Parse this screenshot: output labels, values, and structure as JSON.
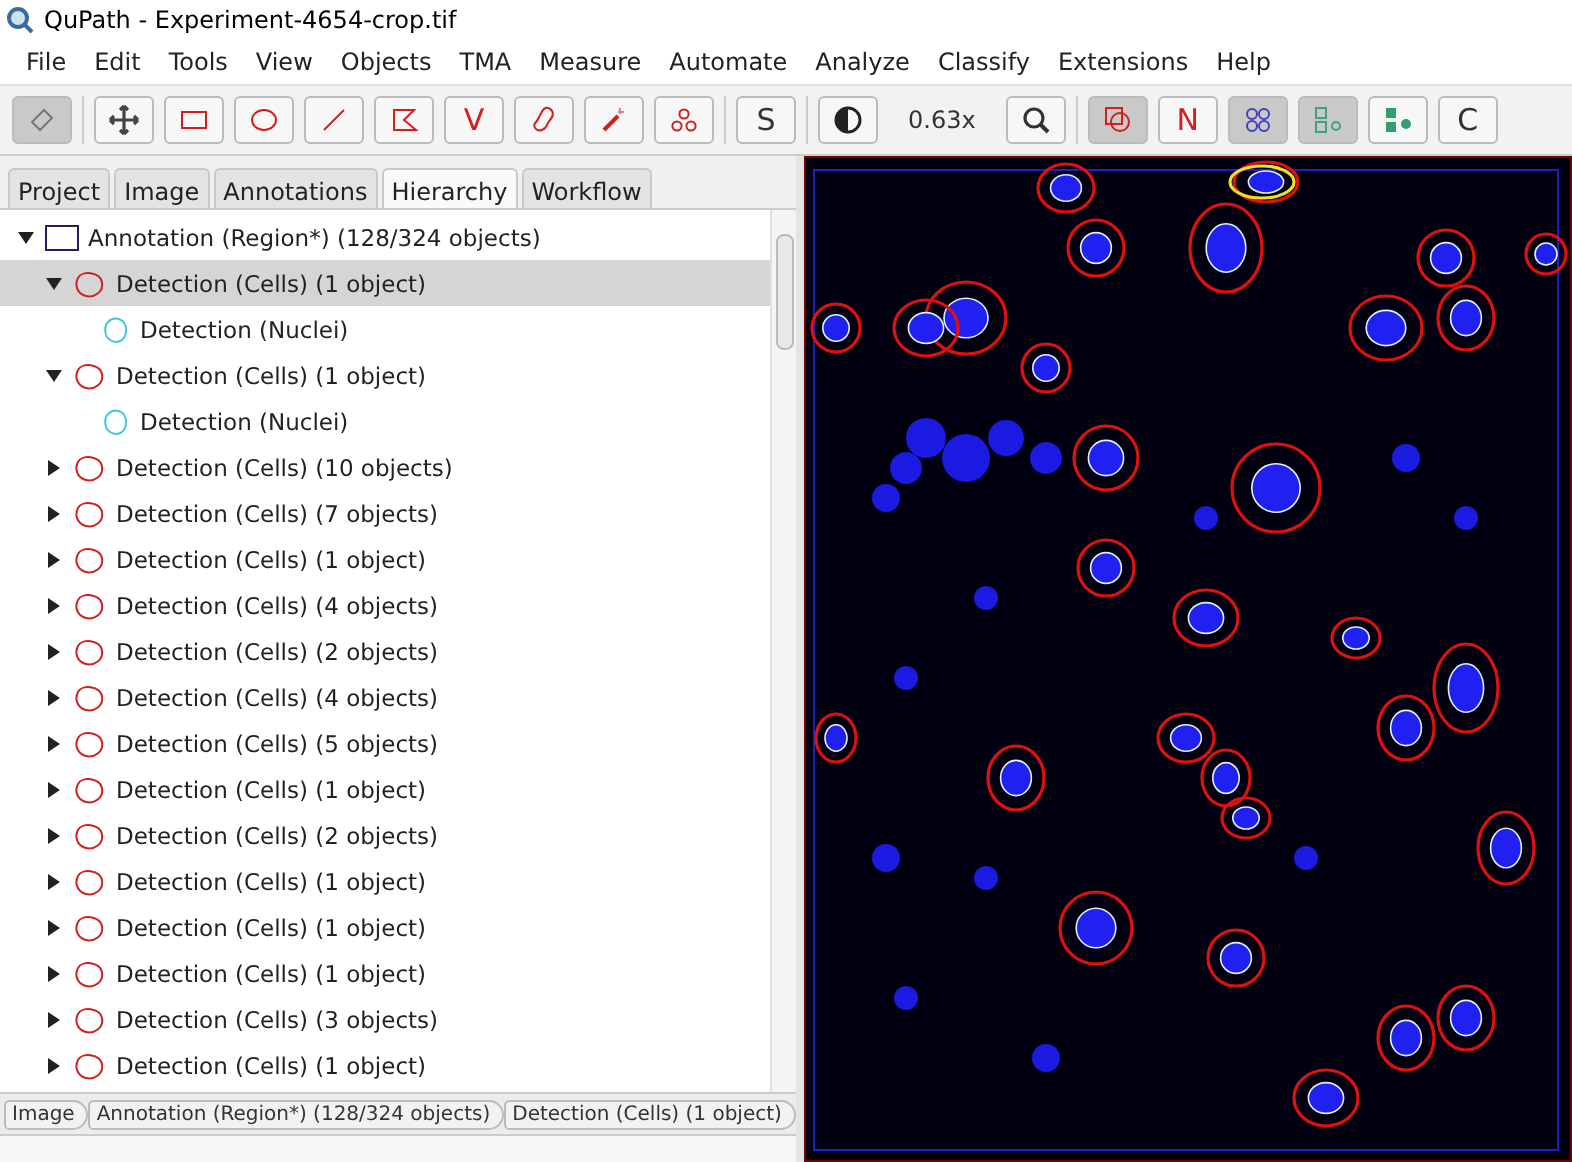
{
  "window": {
    "title": "QuPath - Experiment-4654-crop.tif"
  },
  "menu": [
    "File",
    "Edit",
    "Tools",
    "View",
    "Objects",
    "TMA",
    "Measure",
    "Automate",
    "Analyze",
    "Classify",
    "Extensions",
    "Help"
  ],
  "toolbar": [
    {
      "kind": "icon",
      "selected": true
    },
    {
      "kind": "sep"
    },
    {
      "kind": "icon",
      "selected": false
    },
    {
      "kind": "icon",
      "selected": false
    },
    {
      "kind": "icon",
      "selected": false
    },
    {
      "kind": "icon",
      "selected": false
    },
    {
      "kind": "icon",
      "selected": false
    },
    {
      "kind": "text",
      "label": "V",
      "selected": false,
      "color": "#d02020"
    },
    {
      "kind": "icon",
      "selected": false
    },
    {
      "kind": "icon",
      "selected": false
    },
    {
      "kind": "icon",
      "selected": false
    },
    {
      "kind": "sep"
    },
    {
      "kind": "text",
      "label": "S",
      "selected": false,
      "color": "#333333"
    },
    {
      "kind": "sep"
    },
    {
      "kind": "icon",
      "selected": false
    },
    {
      "kind": "label",
      "label": "0.63x"
    },
    {
      "kind": "icon",
      "selected": false
    },
    {
      "kind": "sep"
    },
    {
      "kind": "icon",
      "selected": true
    },
    {
      "kind": "text",
      "label": "N",
      "selected": false,
      "color": "#d02020"
    },
    {
      "kind": "icon",
      "selected": true
    },
    {
      "kind": "icon",
      "selected": true
    },
    {
      "kind": "icon",
      "selected": false
    },
    {
      "kind": "text",
      "label": "C",
      "selected": false,
      "color": "#333333"
    }
  ],
  "tabs": [
    {
      "label": "Project",
      "selected": false
    },
    {
      "label": "Image",
      "selected": false
    },
    {
      "label": "Annotations",
      "selected": false
    },
    {
      "label": "Hierarchy",
      "selected": true
    },
    {
      "label": "Workflow",
      "selected": false
    }
  ],
  "tree": [
    {
      "kind": "annotation",
      "label": "Annotation (Region*) (128/324 objects)",
      "expanded": true,
      "selected": false,
      "children": [
        {
          "kind": "cells",
          "label": "Detection (Cells) (1 object)",
          "expanded": true,
          "selected": true,
          "children": [
            {
              "kind": "nuclei",
              "label": "Detection (Nuclei)",
              "selected": false
            }
          ]
        },
        {
          "kind": "cells",
          "label": "Detection (Cells) (1 object)",
          "expanded": true,
          "selected": false,
          "children": [
            {
              "kind": "nuclei",
              "label": "Detection (Nuclei)",
              "selected": false
            }
          ]
        },
        {
          "kind": "cells",
          "label": "Detection (Cells) (10 objects)",
          "expanded": false,
          "selected": false
        },
        {
          "kind": "cells",
          "label": "Detection (Cells) (7 objects)",
          "expanded": false,
          "selected": false
        },
        {
          "kind": "cells",
          "label": "Detection (Cells) (1 object)",
          "expanded": false,
          "selected": false
        },
        {
          "kind": "cells",
          "label": "Detection (Cells) (4 objects)",
          "expanded": false,
          "selected": false
        },
        {
          "kind": "cells",
          "label": "Detection (Cells) (2 objects)",
          "expanded": false,
          "selected": false
        },
        {
          "kind": "cells",
          "label": "Detection (Cells) (4 objects)",
          "expanded": false,
          "selected": false
        },
        {
          "kind": "cells",
          "label": "Detection (Cells) (5 objects)",
          "expanded": false,
          "selected": false
        },
        {
          "kind": "cells",
          "label": "Detection (Cells) (1 object)",
          "expanded": false,
          "selected": false
        },
        {
          "kind": "cells",
          "label": "Detection (Cells) (2 objects)",
          "expanded": false,
          "selected": false
        },
        {
          "kind": "cells",
          "label": "Detection (Cells) (1 object)",
          "expanded": false,
          "selected": false
        },
        {
          "kind": "cells",
          "label": "Detection (Cells) (1 object)",
          "expanded": false,
          "selected": false
        },
        {
          "kind": "cells",
          "label": "Detection (Cells) (1 object)",
          "expanded": false,
          "selected": false
        },
        {
          "kind": "cells",
          "label": "Detection (Cells) (3 objects)",
          "expanded": false,
          "selected": false
        },
        {
          "kind": "cells",
          "label": "Detection (Cells) (1 object)",
          "expanded": false,
          "selected": false
        }
      ]
    }
  ],
  "breadcrumb": [
    "Image",
    "Annotation (Region*) (128/324 objects)",
    "Detection (Cells) (1 object)"
  ]
}
